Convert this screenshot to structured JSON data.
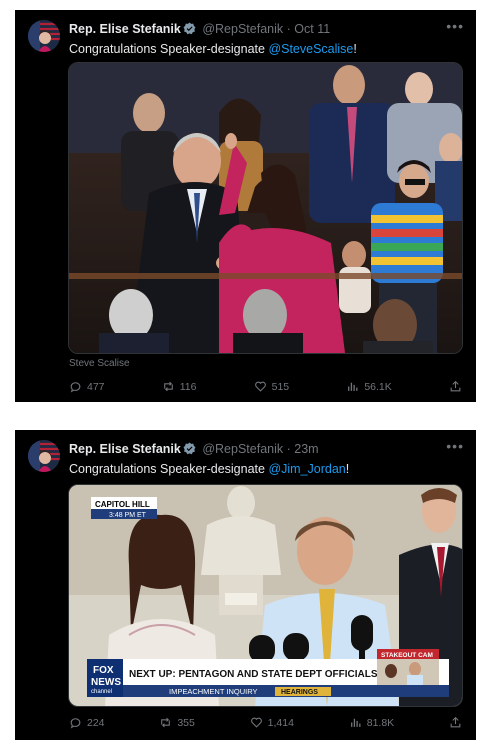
{
  "tweets": [
    {
      "author": "Rep. Elise Stefanik",
      "handle": "@RepStefanik",
      "separator": "·",
      "time": "Oct 11",
      "text_prefix": "Congratulations Speaker-designate ",
      "mention": "@SteveScalise",
      "text_suffix": "!",
      "media_caption": "Steve Scalise",
      "stats": {
        "replies": "477",
        "retweets": "116",
        "likes": "515",
        "views": "56.1K"
      }
    },
    {
      "author": "Rep. Elise Stefanik",
      "handle": "@RepStefanik",
      "separator": "·",
      "time": "23m",
      "text_prefix": "Congratulations Speaker-designate ",
      "mention": "@Jim_Jordan",
      "text_suffix": "!",
      "broadcast": {
        "location": "CAPITOL HILL",
        "clock": "3:48 PM ET",
        "network_line1": "FOX",
        "network_line2": "NEWS",
        "network_line3": "channel",
        "headline": "NEXT UP: PENTAGON AND STATE DEPT OFFICIALS TESTIFY",
        "subline": "IMPEACHMENT INQUIRY",
        "subline_tag": "HEARINGS",
        "cam_label": "STAKEOUT CAM"
      },
      "stats": {
        "replies": "224",
        "retweets": "355",
        "likes": "1,414",
        "views": "81.8K"
      }
    }
  ],
  "colors": {
    "background": "#000000",
    "text": "#e7e9ea",
    "muted": "#71767b",
    "link": "#1d9bf0",
    "verified": "#829aab"
  },
  "icons": [
    "avatar-flag",
    "verified-badge-icon",
    "more-icon",
    "reply-icon",
    "retweet-icon",
    "like-icon",
    "views-icon",
    "share-icon"
  ]
}
